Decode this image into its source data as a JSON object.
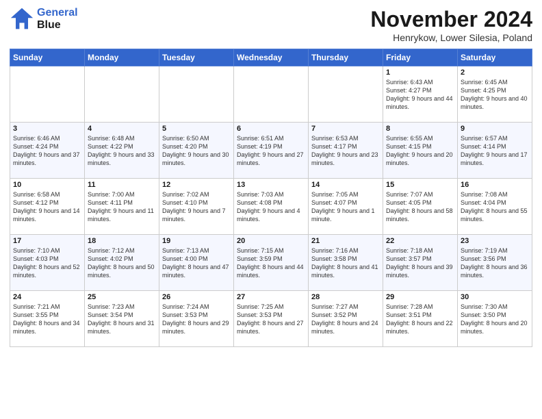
{
  "header": {
    "logo_line1": "General",
    "logo_line2": "Blue",
    "month_title": "November 2024",
    "subtitle": "Henrykow, Lower Silesia, Poland"
  },
  "days_of_week": [
    "Sunday",
    "Monday",
    "Tuesday",
    "Wednesday",
    "Thursday",
    "Friday",
    "Saturday"
  ],
  "weeks": [
    [
      {
        "day": "",
        "info": ""
      },
      {
        "day": "",
        "info": ""
      },
      {
        "day": "",
        "info": ""
      },
      {
        "day": "",
        "info": ""
      },
      {
        "day": "",
        "info": ""
      },
      {
        "day": "1",
        "info": "Sunrise: 6:43 AM\nSunset: 4:27 PM\nDaylight: 9 hours and 44 minutes."
      },
      {
        "day": "2",
        "info": "Sunrise: 6:45 AM\nSunset: 4:25 PM\nDaylight: 9 hours and 40 minutes."
      }
    ],
    [
      {
        "day": "3",
        "info": "Sunrise: 6:46 AM\nSunset: 4:24 PM\nDaylight: 9 hours and 37 minutes."
      },
      {
        "day": "4",
        "info": "Sunrise: 6:48 AM\nSunset: 4:22 PM\nDaylight: 9 hours and 33 minutes."
      },
      {
        "day": "5",
        "info": "Sunrise: 6:50 AM\nSunset: 4:20 PM\nDaylight: 9 hours and 30 minutes."
      },
      {
        "day": "6",
        "info": "Sunrise: 6:51 AM\nSunset: 4:19 PM\nDaylight: 9 hours and 27 minutes."
      },
      {
        "day": "7",
        "info": "Sunrise: 6:53 AM\nSunset: 4:17 PM\nDaylight: 9 hours and 23 minutes."
      },
      {
        "day": "8",
        "info": "Sunrise: 6:55 AM\nSunset: 4:15 PM\nDaylight: 9 hours and 20 minutes."
      },
      {
        "day": "9",
        "info": "Sunrise: 6:57 AM\nSunset: 4:14 PM\nDaylight: 9 hours and 17 minutes."
      }
    ],
    [
      {
        "day": "10",
        "info": "Sunrise: 6:58 AM\nSunset: 4:12 PM\nDaylight: 9 hours and 14 minutes."
      },
      {
        "day": "11",
        "info": "Sunrise: 7:00 AM\nSunset: 4:11 PM\nDaylight: 9 hours and 11 minutes."
      },
      {
        "day": "12",
        "info": "Sunrise: 7:02 AM\nSunset: 4:10 PM\nDaylight: 9 hours and 7 minutes."
      },
      {
        "day": "13",
        "info": "Sunrise: 7:03 AM\nSunset: 4:08 PM\nDaylight: 9 hours and 4 minutes."
      },
      {
        "day": "14",
        "info": "Sunrise: 7:05 AM\nSunset: 4:07 PM\nDaylight: 9 hours and 1 minute."
      },
      {
        "day": "15",
        "info": "Sunrise: 7:07 AM\nSunset: 4:05 PM\nDaylight: 8 hours and 58 minutes."
      },
      {
        "day": "16",
        "info": "Sunrise: 7:08 AM\nSunset: 4:04 PM\nDaylight: 8 hours and 55 minutes."
      }
    ],
    [
      {
        "day": "17",
        "info": "Sunrise: 7:10 AM\nSunset: 4:03 PM\nDaylight: 8 hours and 52 minutes."
      },
      {
        "day": "18",
        "info": "Sunrise: 7:12 AM\nSunset: 4:02 PM\nDaylight: 8 hours and 50 minutes."
      },
      {
        "day": "19",
        "info": "Sunrise: 7:13 AM\nSunset: 4:00 PM\nDaylight: 8 hours and 47 minutes."
      },
      {
        "day": "20",
        "info": "Sunrise: 7:15 AM\nSunset: 3:59 PM\nDaylight: 8 hours and 44 minutes."
      },
      {
        "day": "21",
        "info": "Sunrise: 7:16 AM\nSunset: 3:58 PM\nDaylight: 8 hours and 41 minutes."
      },
      {
        "day": "22",
        "info": "Sunrise: 7:18 AM\nSunset: 3:57 PM\nDaylight: 8 hours and 39 minutes."
      },
      {
        "day": "23",
        "info": "Sunrise: 7:19 AM\nSunset: 3:56 PM\nDaylight: 8 hours and 36 minutes."
      }
    ],
    [
      {
        "day": "24",
        "info": "Sunrise: 7:21 AM\nSunset: 3:55 PM\nDaylight: 8 hours and 34 minutes."
      },
      {
        "day": "25",
        "info": "Sunrise: 7:23 AM\nSunset: 3:54 PM\nDaylight: 8 hours and 31 minutes."
      },
      {
        "day": "26",
        "info": "Sunrise: 7:24 AM\nSunset: 3:53 PM\nDaylight: 8 hours and 29 minutes."
      },
      {
        "day": "27",
        "info": "Sunrise: 7:25 AM\nSunset: 3:53 PM\nDaylight: 8 hours and 27 minutes."
      },
      {
        "day": "28",
        "info": "Sunrise: 7:27 AM\nSunset: 3:52 PM\nDaylight: 8 hours and 24 minutes."
      },
      {
        "day": "29",
        "info": "Sunrise: 7:28 AM\nSunset: 3:51 PM\nDaylight: 8 hours and 22 minutes."
      },
      {
        "day": "30",
        "info": "Sunrise: 7:30 AM\nSunset: 3:50 PM\nDaylight: 8 hours and 20 minutes."
      }
    ]
  ]
}
